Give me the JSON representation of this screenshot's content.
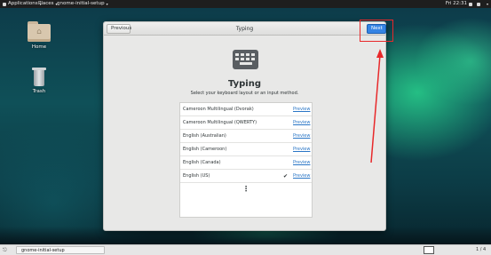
{
  "topbar": {
    "applications": "Applications",
    "places": "Places",
    "app_title": "gnome-initial-setup",
    "clock": "Fri 22:31"
  },
  "desktop": {
    "home_label": "Home",
    "trash_label": "Trash"
  },
  "dialog": {
    "previous_label": "Previous",
    "next_label": "Next",
    "title": "Typing",
    "heading": "Typing",
    "subtitle": "Select your keyboard layout or an input method.",
    "layouts": [
      {
        "name": "Cameroon Multilingual (Dvorak)",
        "preview": "Preview",
        "selected": false
      },
      {
        "name": "Cameroon Multilingual (QWERTY)",
        "preview": "Preview",
        "selected": false
      },
      {
        "name": "English (Australian)",
        "preview": "Preview",
        "selected": false
      },
      {
        "name": "English (Cameroon)",
        "preview": "Preview",
        "selected": false
      },
      {
        "name": "English (Canada)",
        "preview": "Preview",
        "selected": false
      },
      {
        "name": "English (US)",
        "preview": "Preview",
        "selected": true
      }
    ],
    "check_glyph": "✔",
    "more_glyph": "⋮"
  },
  "taskbar": {
    "window_item": "gnome-initial-setup",
    "workspace_count": "1 / 4"
  },
  "colors": {
    "accent": "#3584e4",
    "annotation": "#e8282a",
    "link": "#2a76c6"
  }
}
